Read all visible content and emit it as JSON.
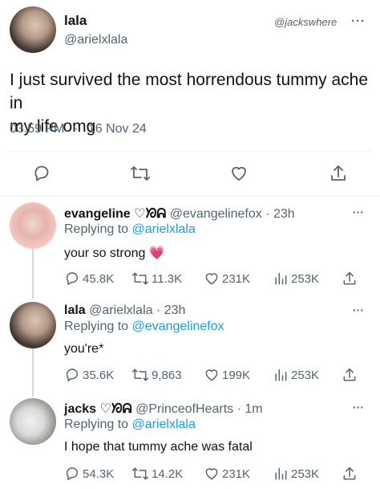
{
  "main_tweet": {
    "display_name": "lala",
    "handle": "@arielxlala",
    "watermark": "@jackswhere",
    "text_line1": "I just survived the most horrendous tummy ache in",
    "text_line2": "my life omg",
    "time": "03:59 PM",
    "dot": "·",
    "date": "16 Nov 24",
    "more": "···"
  },
  "replies": [
    {
      "display_name": "evangeline ♡ᘞᕱ",
      "handle": "@evangelinefox",
      "age": "· 23h",
      "replying_prefix": "Replying to ",
      "replying_to": "@arielxlala",
      "text": "your so strong",
      "emoji": "💗",
      "replies": "45.8K",
      "retweets": "11.3K",
      "likes": "231K",
      "views": "253K",
      "more": "···"
    },
    {
      "display_name": "lala",
      "handle": "@arielxlala",
      "age": "· 23h",
      "replying_prefix": "Replying to ",
      "replying_to": "@evangelinefox",
      "text": "you're*",
      "replies": "35.6K",
      "retweets": "9,863",
      "likes": "199K",
      "views": "253K",
      "more": "···"
    },
    {
      "display_name": "jacks ♡ᘞᕱ",
      "handle": "@PrinceofHearts",
      "age": "· 1m",
      "replying_prefix": "Replying to ",
      "replying_to": "@arielxlala",
      "text": "I hope that tummy ache was fatal",
      "replies": "54.3K",
      "retweets": "14.2K",
      "likes": "231K",
      "views": "253K",
      "more": "···"
    }
  ],
  "colors": {
    "text": "#0f1419",
    "secondary": "#536471",
    "link": "#1d9bf0",
    "divider": "#eff3f4",
    "watermark_heart": "#f91880"
  }
}
